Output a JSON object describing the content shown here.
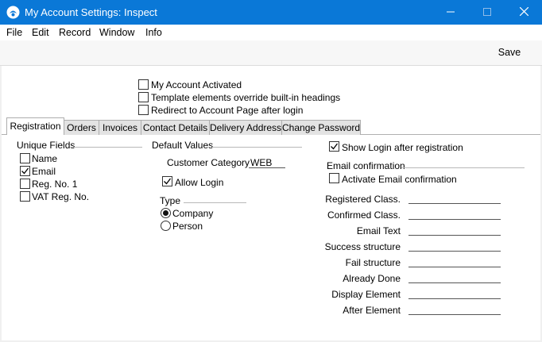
{
  "window": {
    "title": "My Account Settings: Inspect",
    "icon": "app-logo-icon",
    "controls": [
      "minimize-icon",
      "maximize-icon",
      "close-icon"
    ]
  },
  "menu": [
    "File",
    "Edit",
    "Record",
    "Window",
    "Info"
  ],
  "toolbar": {
    "save_label": "Save"
  },
  "options": [
    {
      "label": "My Account Activated",
      "checked": false
    },
    {
      "label": "Template elements override built-in headings",
      "checked": false
    },
    {
      "label": "Redirect to Account Page after login",
      "checked": false
    }
  ],
  "tabs": [
    {
      "label": "Registration",
      "active": true
    },
    {
      "label": "Orders",
      "active": false
    },
    {
      "label": "Invoices",
      "active": false
    },
    {
      "label": "Contact Details",
      "active": false
    },
    {
      "label": "Delivery Address",
      "active": false
    },
    {
      "label": "Change Password",
      "active": false
    }
  ],
  "unique_fields": {
    "title": "Unique Fields",
    "items": [
      {
        "label": "Name",
        "checked": false
      },
      {
        "label": "Email",
        "checked": true
      },
      {
        "label": "Reg. No. 1",
        "checked": false
      },
      {
        "label": "VAT Reg. No.",
        "checked": false
      }
    ]
  },
  "default_values": {
    "title": "Default Values",
    "customer_category_label": "Customer Category",
    "customer_category_value": "WEB",
    "allow_login": {
      "label": "Allow Login",
      "checked": true
    },
    "type_title": "Type",
    "type_options": [
      {
        "label": "Company",
        "selected": true
      },
      {
        "label": "Person",
        "selected": false
      }
    ]
  },
  "right_panel": {
    "show_login": {
      "label": "Show Login after registration",
      "checked": true
    },
    "email_confirmation_title": "Email confirmation",
    "activate_email": {
      "label": "Activate Email confirmation",
      "checked": false
    },
    "fields": [
      {
        "label": "Registered Class.",
        "value": ""
      },
      {
        "label": "Confirmed  Class.",
        "value": ""
      },
      {
        "label": "Email Text",
        "value": ""
      },
      {
        "label": "Success structure",
        "value": ""
      },
      {
        "label": "Fail structure",
        "value": ""
      },
      {
        "label": "Already Done",
        "value": ""
      },
      {
        "label": "Display Element",
        "value": ""
      },
      {
        "label": "After Element",
        "value": ""
      }
    ]
  },
  "colors": {
    "titlebar": "#0a78d7",
    "background": "#f0f0f0",
    "form": "#ffffff"
  }
}
